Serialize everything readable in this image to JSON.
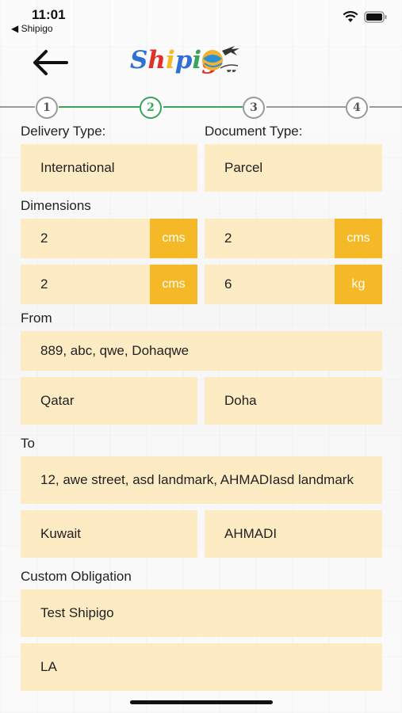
{
  "status_bar": {
    "time": "11:01",
    "back_app": "◀ Shipigo"
  },
  "header": {
    "logo_text": "Shipigo"
  },
  "stepper": {
    "steps": [
      "1",
      "2",
      "3",
      "4"
    ],
    "active_step": 2
  },
  "colors": {
    "field_bg": "#fdebc4",
    "unit_bg": "#f5b927",
    "step_active": "#3aa35b",
    "step_inactive": "#9a9a9a"
  },
  "form": {
    "delivery_type": {
      "label": "Delivery Type:",
      "value": "International"
    },
    "document_type": {
      "label": "Document Type:",
      "value": "Parcel"
    },
    "dimensions": {
      "label": "Dimensions",
      "length": {
        "value": "2",
        "unit": "cms"
      },
      "width": {
        "value": "2",
        "unit": "cms"
      },
      "height": {
        "value": "2",
        "unit": "cms"
      },
      "weight": {
        "value": "6",
        "unit": "kg"
      }
    },
    "from": {
      "label": "From",
      "address": "889, abc, qwe, Dohaqwe",
      "country": "Qatar",
      "city": "Doha"
    },
    "to": {
      "label": "To",
      "address": "12, awe street, asd landmark, AHMADIasd landmark",
      "country": "Kuwait",
      "city": "AHMADI"
    },
    "custom_obligation": {
      "label": "Custom Obligation",
      "value1": "Test Shipigo",
      "value2": "LA"
    }
  }
}
